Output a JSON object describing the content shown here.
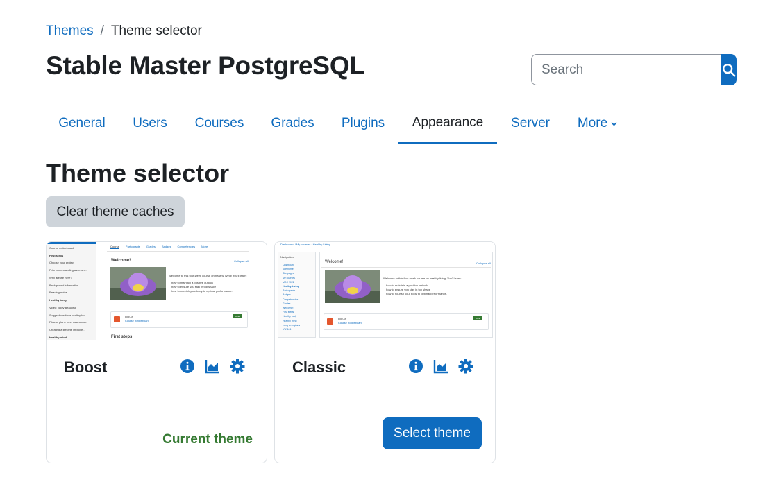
{
  "breadcrumb": {
    "parent": "Themes",
    "separator": "/",
    "current": "Theme selector"
  },
  "site_title": "Stable Master PostgreSQL",
  "search": {
    "placeholder": "Search",
    "icon": "search-icon"
  },
  "nav": {
    "tabs": [
      {
        "label": "General",
        "active": false
      },
      {
        "label": "Users",
        "active": false
      },
      {
        "label": "Courses",
        "active": false
      },
      {
        "label": "Grades",
        "active": false
      },
      {
        "label": "Plugins",
        "active": false
      },
      {
        "label": "Appearance",
        "active": true
      },
      {
        "label": "Server",
        "active": false
      },
      {
        "label": "More",
        "active": false,
        "icon": "chevron-down-icon"
      }
    ]
  },
  "page_heading": "Theme selector",
  "clear_button": "Clear theme caches",
  "themes": [
    {
      "name": "Boost",
      "status": "Current theme",
      "icons": [
        "info-icon",
        "chart-icon",
        "gear-icon"
      ],
      "preview": {
        "tabs": [
          "Course",
          "Participants",
          "Grades",
          "Badges",
          "Competencies",
          "More"
        ],
        "section": "Welcome!",
        "collapse": "Collapse all",
        "intro": "Welcome to this four-week course on healthy living! You'll learn:",
        "bullets": [
          "how to maintain a positive outlook",
          "how to ensure you stay in top shape",
          "how to nourish your body to optimal performance."
        ],
        "activity_type": "FORUM",
        "activity_name": "Course noticeboard",
        "done": "Done",
        "next_section": "First steps",
        "sidebar": [
          "Course noticeboard",
          "First steps",
          "Choose your project",
          "Prior understanding assessm...",
          "Why are we here?",
          "Background information",
          "Reading notes",
          "Healthy body",
          "Video: Body Beautiful",
          "Suggestions for a healthy bo...",
          "Fitness plan - peer assessmen",
          "Creating a lifestyle improve...",
          "Healthy mind"
        ]
      }
    },
    {
      "name": "Classic",
      "action": "Select theme",
      "icons": [
        "info-icon",
        "chart-icon",
        "gear-icon"
      ],
      "preview": {
        "breadcrumb": "Dashboard / My courses / Healthy Living",
        "nav_title": "Navigation",
        "nav_items": [
          "Dashboard",
          "Site home",
          "Site pages",
          "My courses",
          "MCC 2022",
          "Healthy Living",
          "Participants",
          "Badges",
          "Competencies",
          "Grades",
          "Welcome!",
          "First steps",
          "Healthy body",
          "Healthy mind",
          "Long term plans",
          "VW 101"
        ],
        "section": "Welcome!",
        "collapse": "Collapse all",
        "intro": "Welcome to this four-week course on healthy living! You'll learn:",
        "bullets": [
          "how to maintain a positive outlook",
          "how to ensure you stay in top shape",
          "how to nourish your body to optimal performance."
        ],
        "activity_type": "FORUM",
        "activity_name": "Course noticeboard",
        "done": "Done"
      }
    }
  ],
  "colors": {
    "primary": "#0f6cbf",
    "success": "#357a32",
    "secondary_btn": "#ced4da",
    "text": "#1d2125"
  }
}
